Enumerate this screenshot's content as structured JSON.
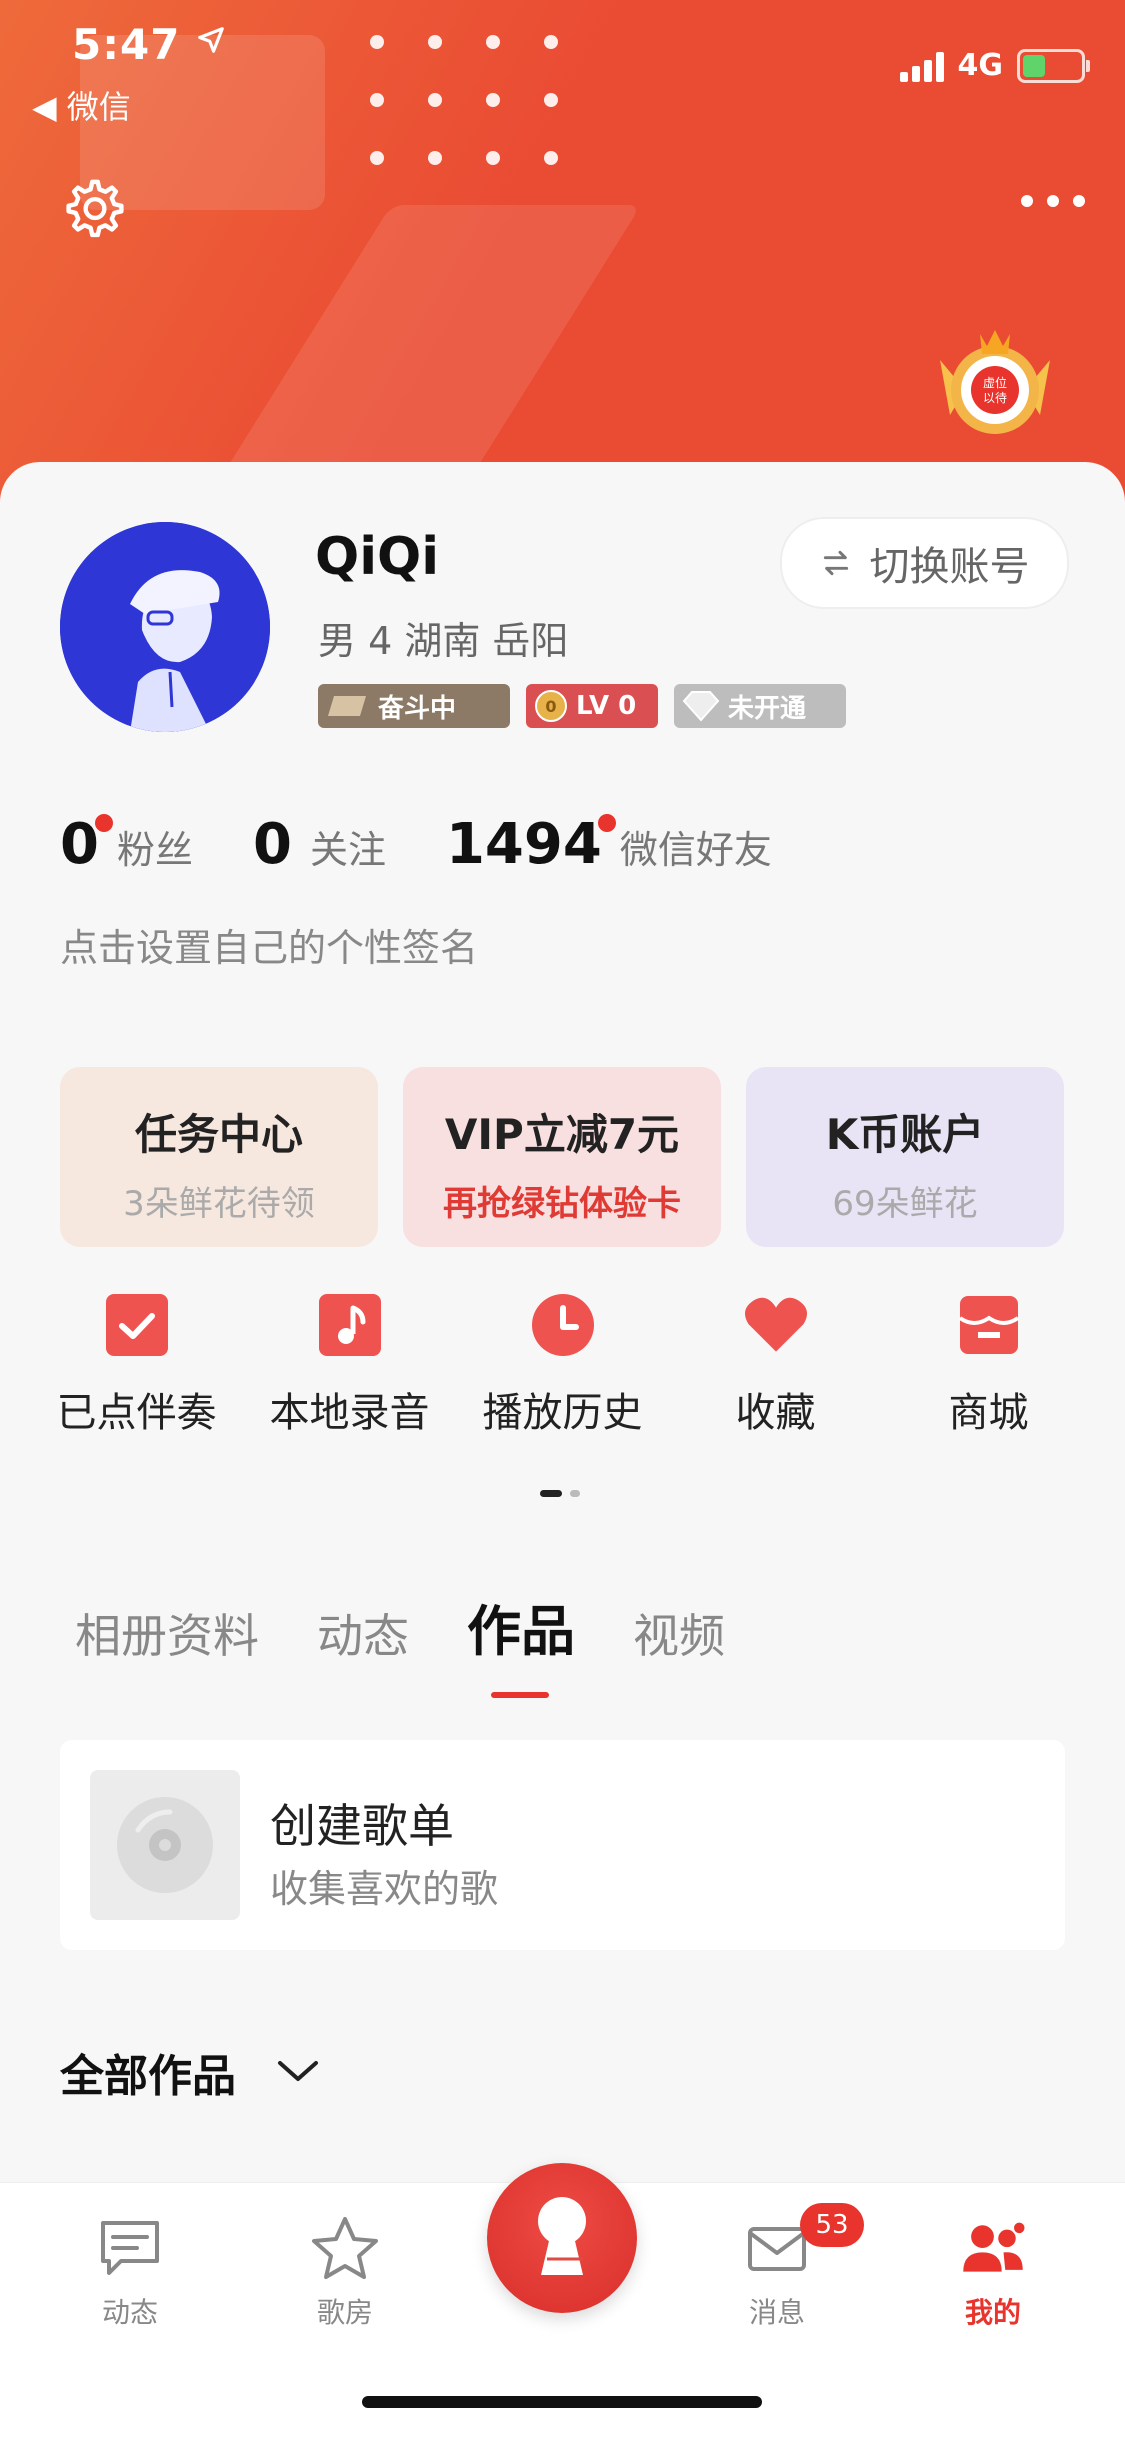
{
  "status_bar": {
    "time": "5:47",
    "back_app": "微信",
    "network": "4G"
  },
  "profile": {
    "name": "QiQi",
    "info": "男 4   湖南 岳阳",
    "switch_label": "切换账号",
    "tags": {
      "struggle": "奋斗中",
      "level": "LV 0",
      "vip": "未开通"
    },
    "badge_text": "虚位以待"
  },
  "stats": {
    "fans_count": "0",
    "fans_label": "粉丝",
    "follow_count": "0",
    "follow_label": "关注",
    "friends_count": "1494",
    "friends_label": "微信好友"
  },
  "signature": "点击设置自己的个性签名",
  "promos": [
    {
      "title": "任务中心",
      "subtitle": "3朵鲜花待领"
    },
    {
      "title": "VIP立减7元",
      "subtitle": "再抢绿钻体验卡"
    },
    {
      "title": "K币账户",
      "subtitle": "69朵鲜花"
    }
  ],
  "quick_actions": [
    {
      "label": "已点伴奏",
      "icon": "checklist-icon"
    },
    {
      "label": "本地录音",
      "icon": "music-note-icon"
    },
    {
      "label": "播放历史",
      "icon": "clock-icon"
    },
    {
      "label": "收藏",
      "icon": "heart-icon"
    },
    {
      "label": "商城",
      "icon": "store-icon"
    }
  ],
  "tabs": [
    "相册资料",
    "动态",
    "作品",
    "视频"
  ],
  "active_tab": "作品",
  "playlist": {
    "title": "创建歌单",
    "subtitle": "收集喜欢的歌"
  },
  "all_works": "全部作品",
  "bottom_nav": [
    {
      "label": "动态",
      "icon": "message-icon"
    },
    {
      "label": "歌房",
      "icon": "star-icon"
    },
    {
      "label": "消息",
      "icon": "mail-icon",
      "badge": "53"
    },
    {
      "label": "我的",
      "icon": "people-icon"
    }
  ],
  "colors": {
    "accent": "#e8342c",
    "header": "#ea4b33"
  }
}
